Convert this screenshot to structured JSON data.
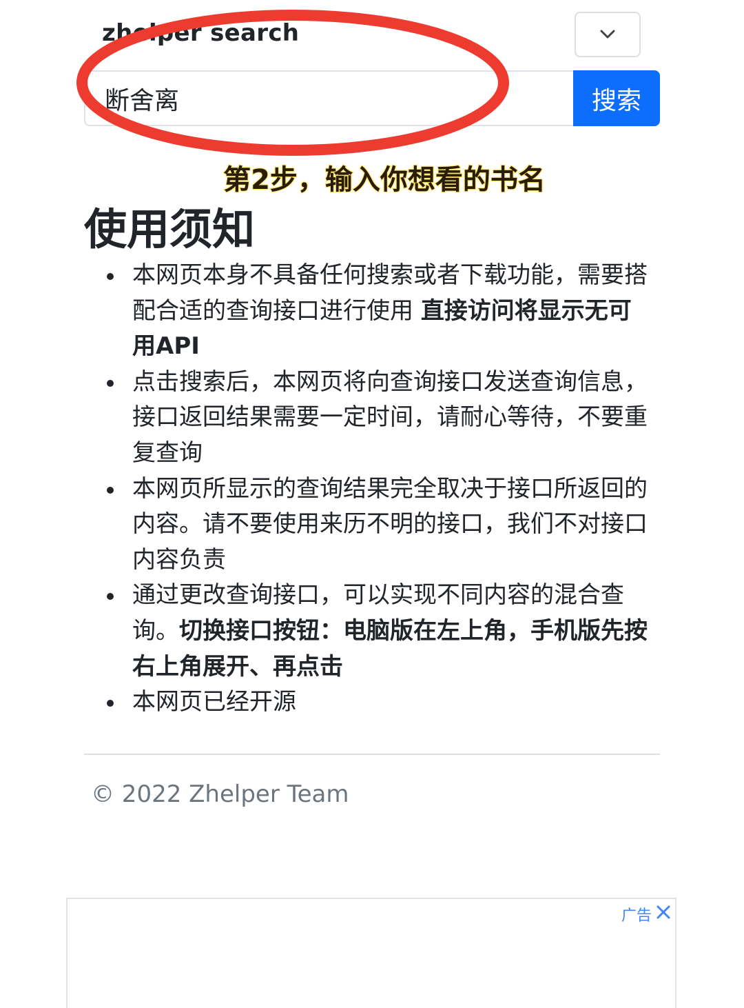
{
  "header": {
    "brand": "zhelper search",
    "menu_toggle_icon": "chevron-down-icon"
  },
  "search": {
    "value": "断舍离",
    "button_label": "搜索"
  },
  "overlay": {
    "annotation": "red-ellipse",
    "caption": "第2步，输入你想看的书名"
  },
  "notice": {
    "title": "使用须知",
    "items": [
      {
        "text": "本网页本身不具备任何搜索或者下载功能，需要搭配合适的查询接口进行使用 ",
        "bold": "直接访问将显示无可用API"
      },
      {
        "text": "点击搜索后，本网页将向查询接口发送查询信息，接口返回结果需要一定时间，请耐心等待，不要重复查询",
        "bold": ""
      },
      {
        "text": "本网页所显示的查询结果完全取决于接口所返回的内容。请不要使用来历不明的接口，我们不对接口内容负责",
        "bold": ""
      },
      {
        "text": "通过更改查询接口，可以实现不同内容的混合查询。",
        "bold": "切换接口按钮：电脑版在左上角，手机版先按右上角展开、再点击"
      },
      {
        "text": "本网页已经开源",
        "bold": ""
      }
    ]
  },
  "footer": {
    "copyright": "© 2022 Zhelper Team"
  },
  "ad": {
    "label": "广告",
    "close_icon": "close-icon"
  },
  "colors": {
    "primary": "#0d6efd",
    "annotation_red": "#ee3b30",
    "caption_outline": "#ffe66b"
  }
}
